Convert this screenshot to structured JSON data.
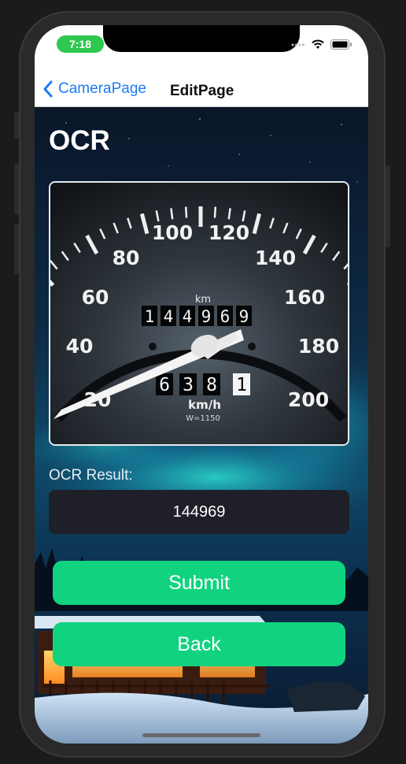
{
  "status_bar": {
    "time": "7:18",
    "icons": [
      "signal-icon",
      "wifi-icon",
      "battery-icon"
    ]
  },
  "nav": {
    "back_label": "CameraPage",
    "title": "EditPage"
  },
  "page": {
    "title": "OCR"
  },
  "gauge": {
    "speed_labels": [
      "20",
      "40",
      "60",
      "80",
      "100",
      "120",
      "140",
      "160",
      "180",
      "200"
    ],
    "unit_top": "km",
    "odometer_digits": [
      "1",
      "4",
      "4",
      "9",
      "6",
      "9"
    ],
    "trip_digits": [
      "6",
      "3",
      "8",
      "1"
    ],
    "unit_bottom": "km/h",
    "spec_text": "W=1150"
  },
  "result": {
    "label": "OCR Result:",
    "value": "144969"
  },
  "buttons": {
    "submit": "Submit",
    "back": "Back"
  },
  "colors": {
    "accent_green": "#11d37f",
    "link_blue": "#1a7cf2",
    "status_green": "#2dc84d"
  }
}
